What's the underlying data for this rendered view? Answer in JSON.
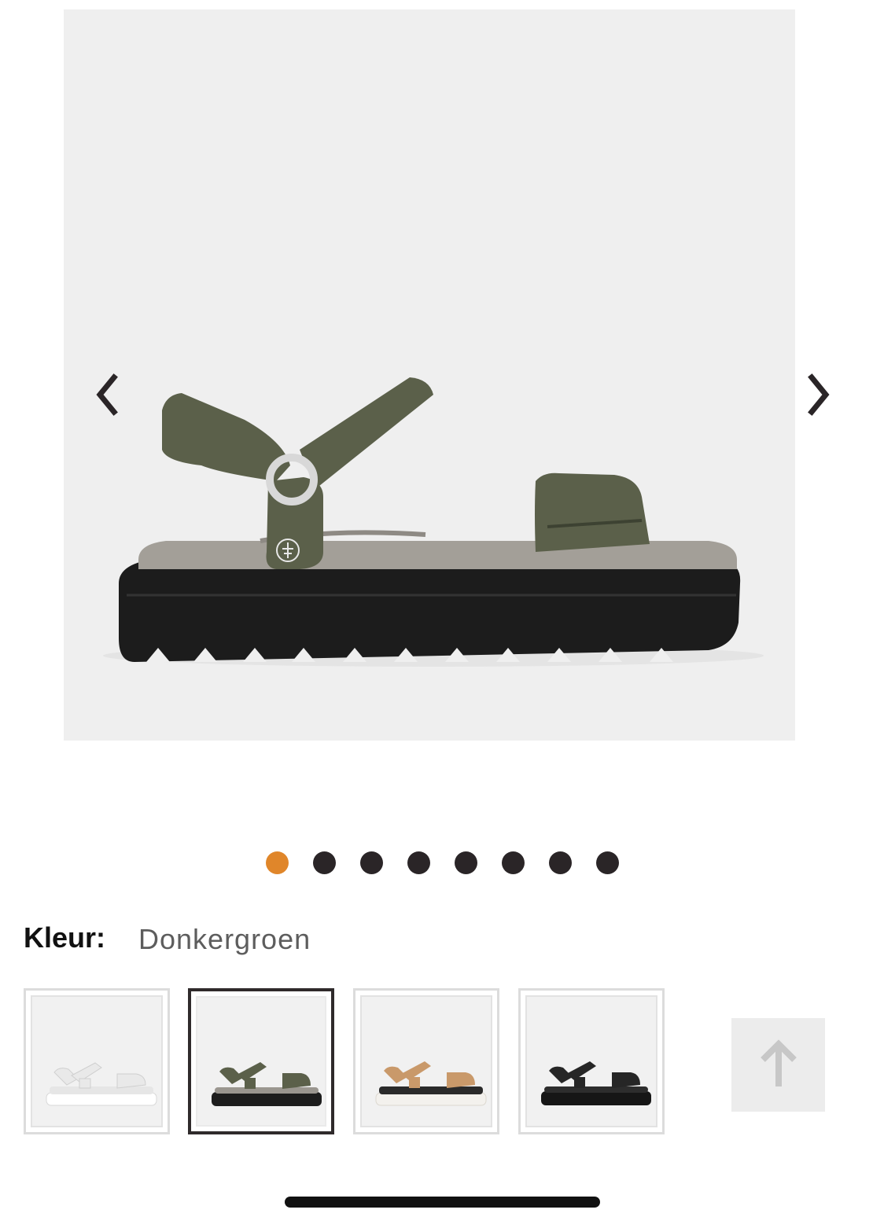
{
  "product": {
    "image_alt": "Donkergroene sandaal",
    "color_label": "Kleur:",
    "color_value": "Donkergroen",
    "accent_color": "#e0862a"
  },
  "gallery": {
    "slide_count": 8,
    "active_slide": 1,
    "prev_icon": "chevron-left-icon",
    "next_icon": "chevron-right-icon"
  },
  "swatches": [
    {
      "color_name": "wit",
      "upper": "#e9e9e9",
      "sole": "#ffffff",
      "selected": false
    },
    {
      "color_name": "donkergroen",
      "upper": "#5b604a",
      "sole": "#1d1d1d",
      "selected": true
    },
    {
      "color_name": "bruin",
      "upper": "#c9996a",
      "sole": "#f3f1ed",
      "selected": false
    },
    {
      "color_name": "zwart",
      "upper": "#262626",
      "sole": "#161616",
      "selected": false
    }
  ],
  "scroll_top": {
    "icon": "arrow-up-icon"
  }
}
